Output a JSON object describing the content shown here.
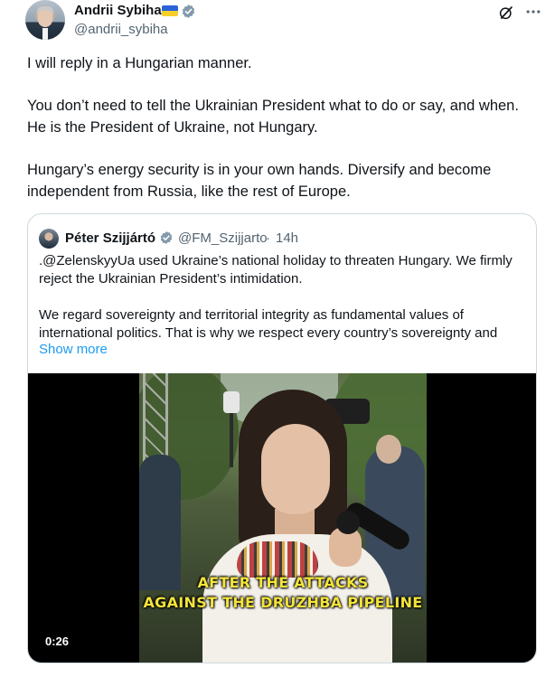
{
  "tweet": {
    "author": {
      "name": "Andrii Sybiha",
      "handle": "@andrii_sybiha",
      "flag_colors": [
        "#2b62d8",
        "#f7cf2a"
      ],
      "verified": true
    },
    "body": [
      "I will reply in a Hungarian manner.",
      "You don’t need to tell the Ukrainian President what to do or say, and when. He is the President of Ukraine, not Hungary.",
      "Hungary’s energy security is in your own hands. Diversify and become independent from Russia, like the rest of Europe."
    ],
    "actions": {
      "grok_icon": "grok-slash-circle-icon",
      "more_icon": "more-horizontal-icon"
    }
  },
  "quote": {
    "author": {
      "name": "Péter Szijjártó",
      "handle": "@FM_Szijjarto",
      "separator": "·",
      "time": "14h",
      "verified": true
    },
    "text": [
      ".@ZelenskyyUa used Ukraine’s national holiday to threaten Hungary. We firmly reject the Ukrainian President’s intimidation.",
      "We regard sovereignty and territorial integrity as fundamental values of international politics. That is why we respect every country’s sovereignty and"
    ],
    "show_more": "Show more",
    "video": {
      "caption_line1": "AFTER THE ATTACKS",
      "caption_line2": "AGAINST THE DRUZHBA PIPELINE",
      "duration": "0:26"
    }
  },
  "colors": {
    "text": "#0f1419",
    "secondary": "#536471",
    "link": "#1d9bf0",
    "border": "#cfd9de",
    "verified": "#829aab",
    "caption": "#f3e43a"
  }
}
